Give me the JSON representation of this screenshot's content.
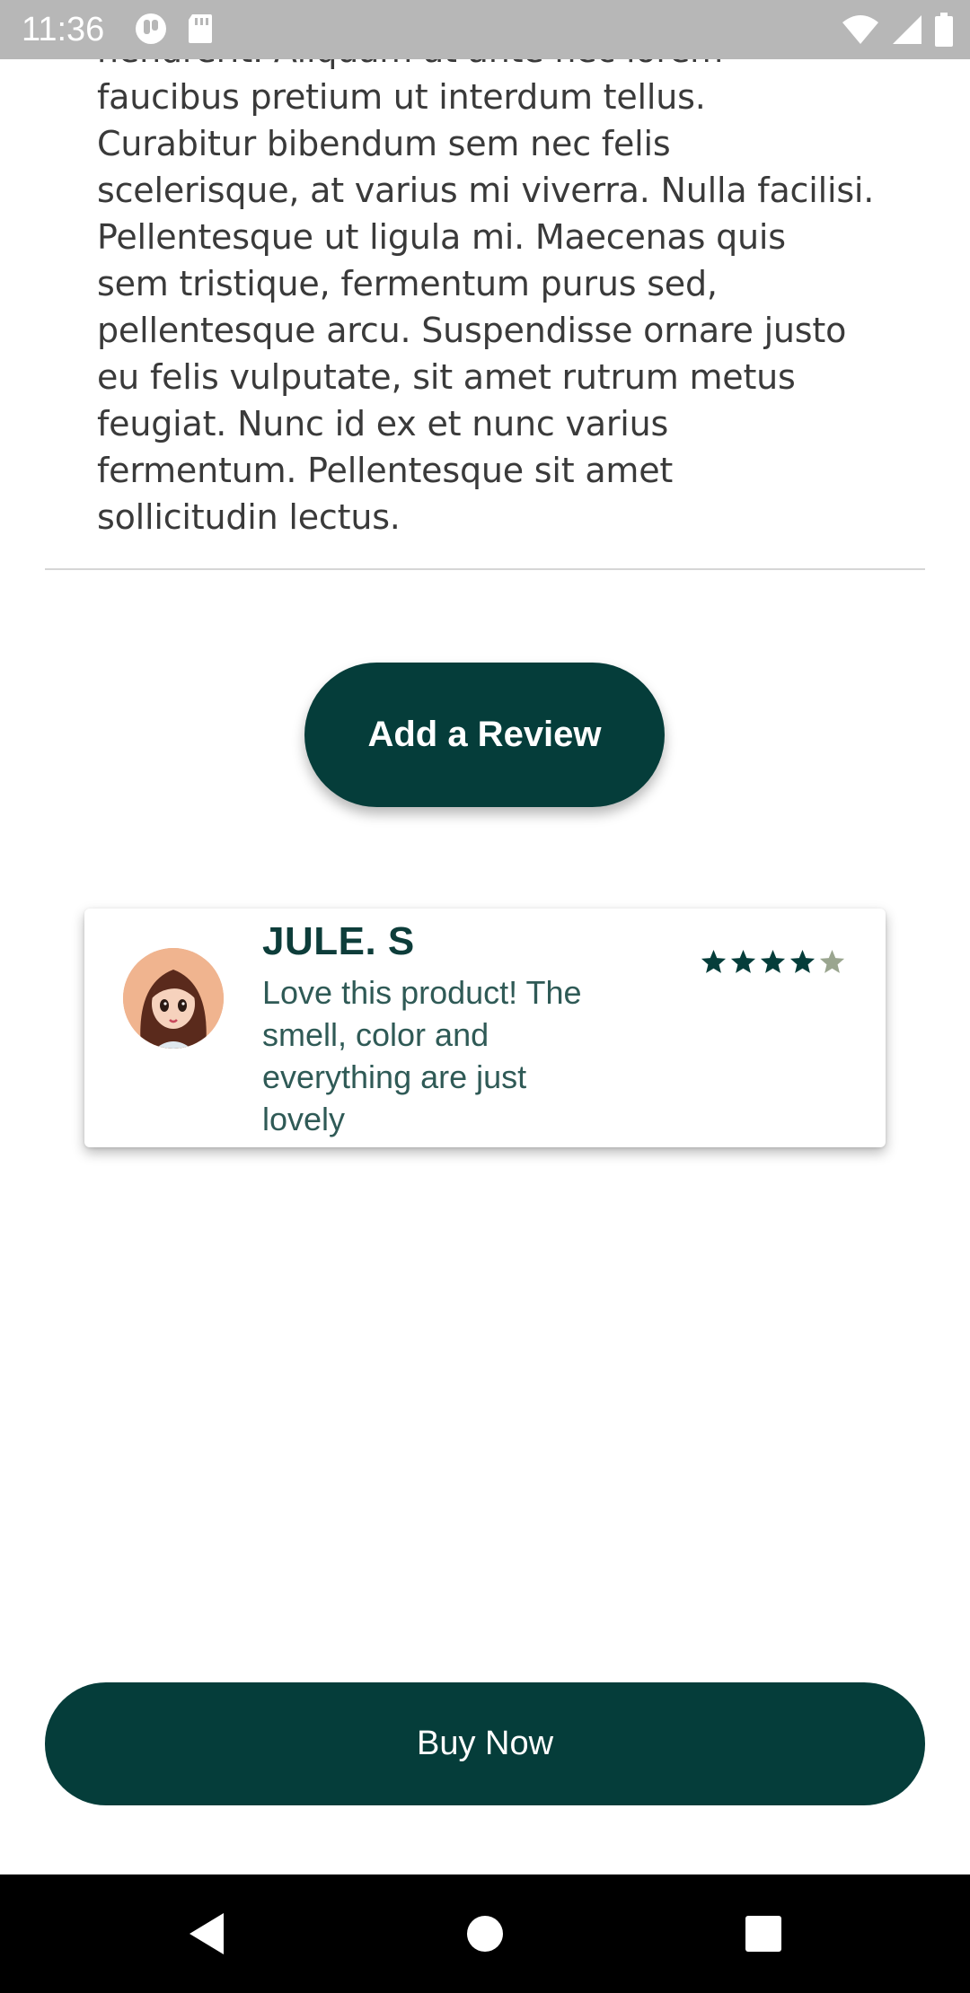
{
  "status_bar": {
    "time": "11:36",
    "left_icons": [
      "notification-app-icon",
      "sd-card-icon"
    ],
    "right_icons": [
      "wifi-icon",
      "cell-signal-icon",
      "battery-icon"
    ]
  },
  "description": {
    "lines": [
      "hendrerit. Aliquam at ante nec lorem",
      "faucibus pretium ut interdum tellus.",
      "Curabitur bibendum sem nec felis",
      "scelerisque, at varius mi viverra. Nulla facilisi.",
      "Pellentesque ut ligula mi. Maecenas quis",
      "sem tristique, fermentum purus sed,",
      "pellentesque arcu. Suspendisse ornare justo",
      "eu felis vulputate, sit amet rutrum metus",
      "feugiat. Nunc id ex et nunc varius",
      "fermentum. Pellentesque sit amet",
      "sollicitudin lectus."
    ]
  },
  "add_review": {
    "label": "Add a Review"
  },
  "review": {
    "name": "JULE. S",
    "text_lines": [
      "Love this product! The",
      "smell, color and",
      "everything are just",
      "lovely"
    ],
    "rating": 4,
    "max_rating": 5
  },
  "buy_now": {
    "label": "Buy Now"
  },
  "colors": {
    "primary": "#053d3a",
    "status_bar": "#b7b7b7",
    "star_filled": "#053d3a",
    "star_empty": "#9aa58f"
  },
  "nav": {
    "buttons": [
      "back-icon",
      "home-icon",
      "recents-icon"
    ]
  }
}
